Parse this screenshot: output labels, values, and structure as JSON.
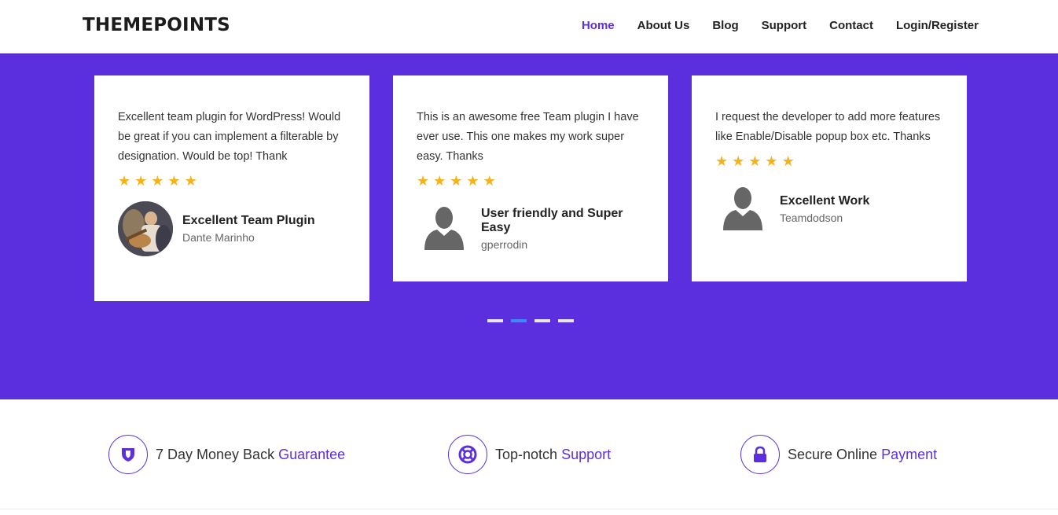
{
  "header": {
    "logo": "THEMEPOINTS",
    "nav": [
      "Home",
      "About Us",
      "Blog",
      "Support",
      "Contact",
      "Login/Register"
    ],
    "active_nav": "Home"
  },
  "testimonials": [
    {
      "quote": "Excellent team plugin for WordPress! Would be great if you can implement a filterable by designation. Would be top! Thank",
      "rating": 5,
      "title": "Excellent Team Plugin",
      "author": "Dante Marinho",
      "avatar": "photo"
    },
    {
      "quote": "This is an awesome free Team plugin I have ever use. This one makes my work super easy.   Thanks",
      "rating": 5,
      "title": "User friendly and Super Easy",
      "author": "gperrodin",
      "avatar": "user-silhouette-icon"
    },
    {
      "quote": "I request the developer to add more features like Enable/Disable popup box etc.   Thanks",
      "rating": 5,
      "title": "Excellent Work",
      "author": "Teamdodson",
      "avatar": "user-silhouette-icon"
    }
  ],
  "carousel": {
    "pages": 4,
    "active_index": 1
  },
  "features": [
    {
      "icon": "shield-icon",
      "text": "7 Day Money Back",
      "accent": "Guarantee"
    },
    {
      "icon": "lifebuoy-icon",
      "text": "Top-notch",
      "accent": "Support"
    },
    {
      "icon": "lock-icon",
      "text": "Secure Online",
      "accent": "Payment"
    }
  ],
  "colors": {
    "brand": "#5c2fde",
    "star": "#f5b21a",
    "dot_active": "#3d8bf2",
    "dot_inactive": "#e8e6f5"
  }
}
